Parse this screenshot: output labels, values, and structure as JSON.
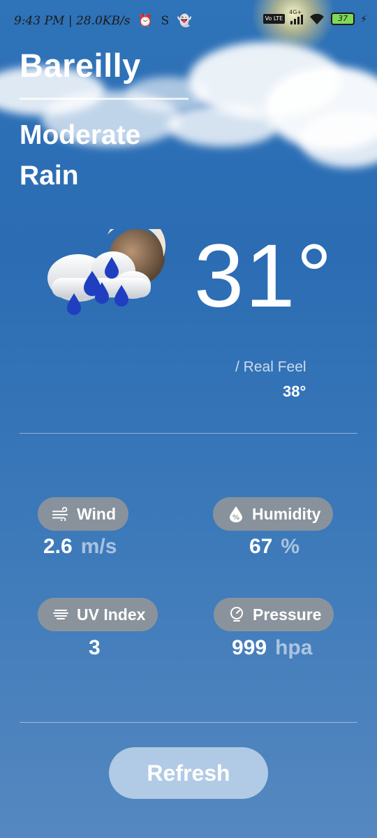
{
  "status_bar": {
    "time_speed": "9:43 PM | 28.0KB/s",
    "network": "4G+",
    "volte": "Vo LTE",
    "battery": "37"
  },
  "location": {
    "city": "Bareilly"
  },
  "current": {
    "condition": "Moderate Rain",
    "temperature": "31°",
    "real_feel_label": "/ Real Feel",
    "real_feel_value": "38°",
    "icon": "cloud-rain-sun-icon"
  },
  "details": {
    "wind": {
      "label": "Wind",
      "value": "2.6",
      "unit": "m/s",
      "icon": "wind-icon"
    },
    "humidity": {
      "label": "Humidity",
      "value": "67",
      "unit": "%",
      "icon": "humidity-icon"
    },
    "uv": {
      "label": "UV Index",
      "value": "3",
      "icon": "uv-index-icon"
    },
    "pressure": {
      "label": "Pressure",
      "value": "999",
      "unit": "hpa",
      "icon": "pressure-icon"
    }
  },
  "actions": {
    "refresh_label": "Refresh"
  },
  "colors": {
    "background_top": "#2f73b8",
    "background_bottom": "#5588c0",
    "chip": "#969696",
    "button": "#d2e1f2"
  }
}
